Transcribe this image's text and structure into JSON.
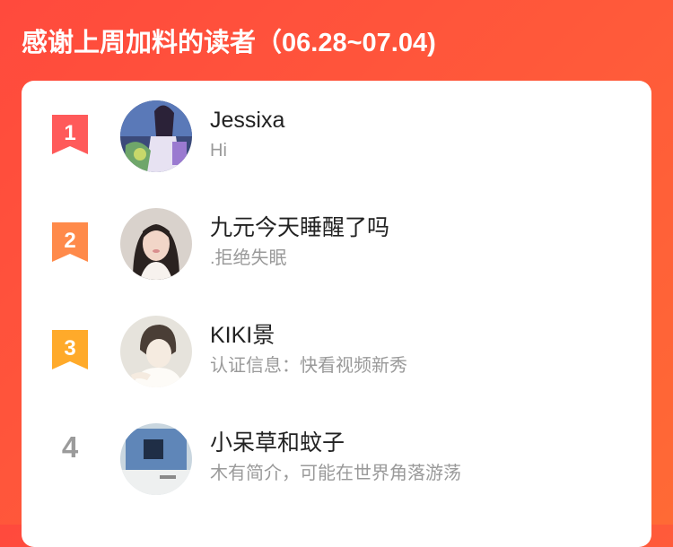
{
  "header": {
    "title": "感谢上周加料的读者（06.28~07.04)"
  },
  "readers": [
    {
      "rank": "1",
      "name": "Jessixa",
      "desc": "Hi",
      "badge_color": "#ff5a5a",
      "avatar_icon": "anime-girl-avatar"
    },
    {
      "rank": "2",
      "name": "九元今天睡醒了吗",
      "desc": ".拒绝失眠",
      "badge_color": "#ff8a4a",
      "avatar_icon": "woman-portrait-avatar"
    },
    {
      "rank": "3",
      "name": "KIKI景",
      "desc": "认证信息：快看视频新秀",
      "badge_color": "#ffaa2a",
      "avatar_icon": "cartoon-boy-avatar"
    },
    {
      "rank": "4",
      "name": "小呆草和蚊子",
      "desc": "木有简介，可能在世界角落游荡",
      "badge_color": "#9b9b9b",
      "avatar_icon": "blue-photo-avatar"
    }
  ]
}
